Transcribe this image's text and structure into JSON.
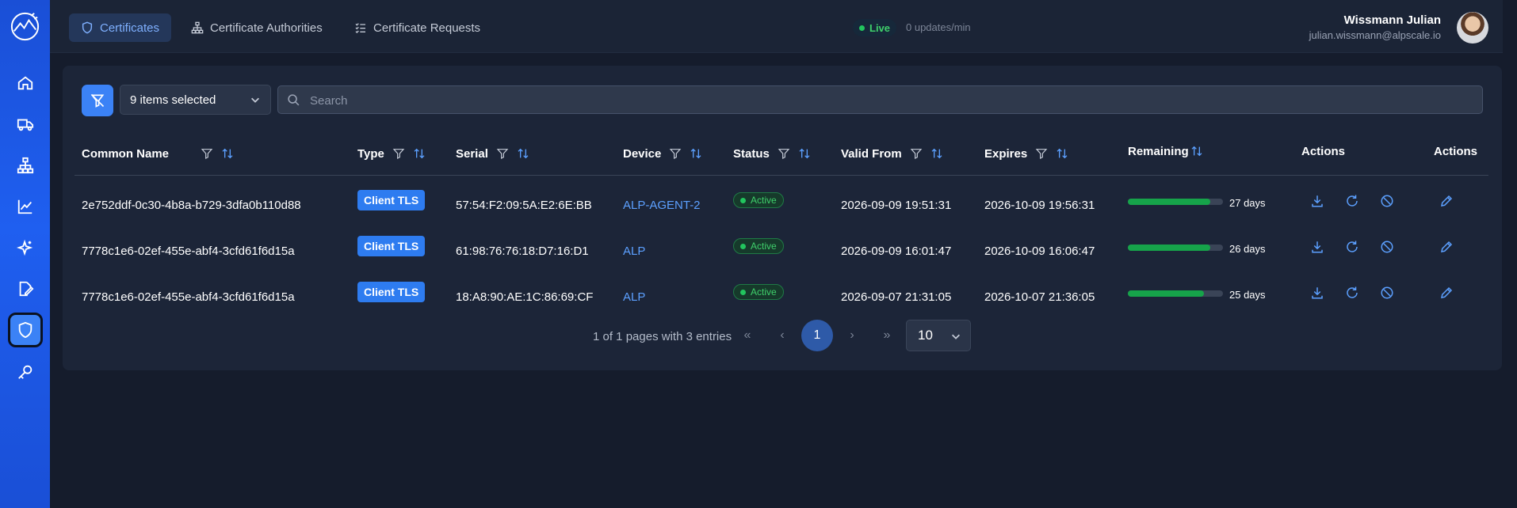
{
  "sidebar": {
    "items": [
      {
        "icon": "home-icon"
      },
      {
        "icon": "truck-icon"
      },
      {
        "icon": "network-icon"
      },
      {
        "icon": "chart-line-icon"
      },
      {
        "icon": "sparkles-icon"
      },
      {
        "icon": "file-signature-icon"
      },
      {
        "icon": "shield-icon",
        "active": true
      },
      {
        "icon": "key-icon"
      }
    ]
  },
  "topbar": {
    "tabs": [
      {
        "label": "Certificates",
        "icon": "shield-icon",
        "active": true
      },
      {
        "label": "Certificate Authorities",
        "icon": "sitemap-icon"
      },
      {
        "label": "Certificate Requests",
        "icon": "list-check-icon"
      }
    ],
    "live_label": "Live",
    "updates": "0 updates/min",
    "user_name": "Wissmann Julian",
    "user_email": "julian.wissmann@alpscale.io"
  },
  "filters": {
    "selected_label": "9 items selected",
    "search_placeholder": "Search"
  },
  "table": {
    "headers": {
      "common_name": "Common Name",
      "type": "Type",
      "serial": "Serial",
      "device": "Device",
      "status": "Status",
      "valid_from": "Valid From",
      "expires": "Expires",
      "remaining": "Remaining",
      "actions1": "Actions",
      "actions2": "Actions"
    },
    "rows": [
      {
        "common_name": "2e752ddf-0c30-4b8a-b729-3dfa0b110d88",
        "type": "Client TLS",
        "serial": "57:54:F2:09:5A:E2:6E:BB",
        "device": "ALP-AGENT-2",
        "status": "Active",
        "valid_from": "2026-09-09 19:51:31",
        "expires": "2026-10-09 19:56:31",
        "remaining_days": "27 days",
        "remaining_fraction": 0.87
      },
      {
        "common_name": "7778c1e6-02ef-455e-abf4-3cfd61f6d15a",
        "type": "Client TLS",
        "serial": "61:98:76:76:18:D7:16:D1",
        "device": "ALP",
        "status": "Active",
        "valid_from": "2026-09-09 16:01:47",
        "expires": "2026-10-09 16:06:47",
        "remaining_days": "26 days",
        "remaining_fraction": 0.87
      },
      {
        "common_name": "7778c1e6-02ef-455e-abf4-3cfd61f6d15a",
        "type": "Client TLS",
        "serial": "18:A8:90:AE:1C:86:69:CF",
        "device": "ALP",
        "status": "Active",
        "valid_from": "2026-09-07 21:31:05",
        "expires": "2026-10-07 21:36:05",
        "remaining_days": "25 days",
        "remaining_fraction": 0.8
      }
    ]
  },
  "pagination": {
    "summary": "1 of 1 pages with 3 entries",
    "first": "«",
    "prev": "‹",
    "current": "1",
    "next": "›",
    "last": "»",
    "page_size": "10"
  }
}
